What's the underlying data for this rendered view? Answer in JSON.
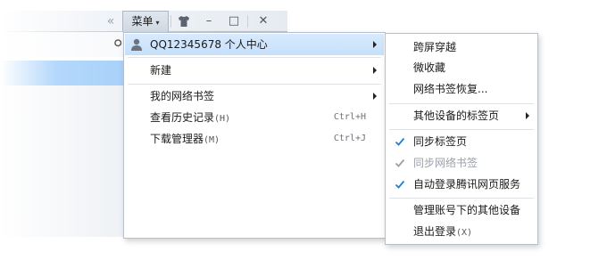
{
  "toolbar": {
    "collapse_glyph": "«",
    "menu_label": "菜单",
    "menu_caret": "▾",
    "skin_glyph": "👕",
    "minimize_glyph": "–",
    "maximize_glyph": "□",
    "close_glyph": "✕"
  },
  "main_menu": {
    "account_label": "QQ12345678 个人中心",
    "new_label": "新建",
    "bookmarks_label": "我的网络书签",
    "history_label": "查看历史记录",
    "history_hotkey": "(H)",
    "history_shortcut": "Ctrl+H",
    "downloads_label": "下载管理器",
    "downloads_hotkey": "(M)",
    "downloads_shortcut": "Ctrl+J"
  },
  "sub_menu": {
    "item_1": "跨屏穿越",
    "item_2": "微收藏",
    "item_3": "网络书签恢复...",
    "other_devices_tabs": "其他设备的标签页",
    "sync_tabs": "同步标签页",
    "sync_bookmarks": "同步网络书签",
    "auto_login": "自动登录腾讯网页服务",
    "manage_devices": "管理账号下的其他设备",
    "logout_label": "退出登录",
    "logout_hotkey": "(X)"
  },
  "colors": {
    "hover": "#c6e0fb",
    "check": "#1e7fd8",
    "check_disabled": "#9aa1a9"
  }
}
